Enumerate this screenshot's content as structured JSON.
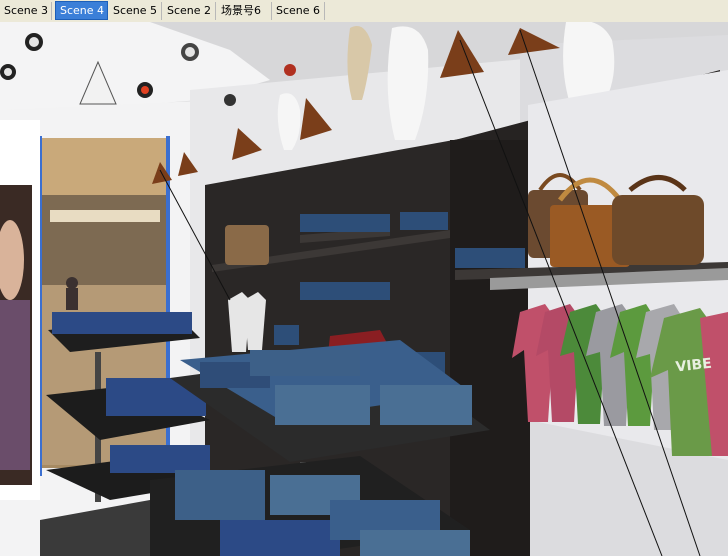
{
  "window": {
    "tabs": [
      {
        "label": "Scene 3",
        "active": false
      },
      {
        "label": "Scene 4",
        "active": true
      },
      {
        "label": "Scene 5",
        "active": false
      },
      {
        "label": "Scene 2",
        "active": false
      },
      {
        "label": "场景号6",
        "active": false
      },
      {
        "label": "Scene 6",
        "active": false
      }
    ]
  },
  "scene": {
    "tshirt_print": "VIBE"
  },
  "colors": {
    "accent": "#3b7fd8",
    "fixture": "#2a2726",
    "wall": "#e8e8ea",
    "denim": "#2d4e78"
  }
}
